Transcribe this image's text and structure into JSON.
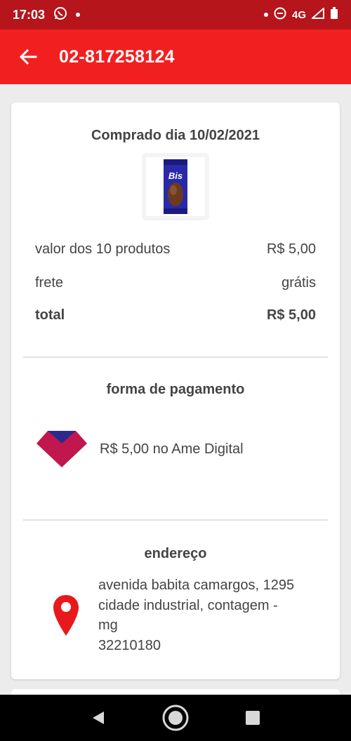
{
  "status": {
    "time": "17:03",
    "network": "4G"
  },
  "header": {
    "title": "02-817258124"
  },
  "order": {
    "date_label": "Comprado dia 10/02/2021",
    "product_image": "bis-chocolate-product"
  },
  "summary": {
    "products_label": "valor dos 10 produtos",
    "products_value": "R$ 5,00",
    "shipping_label": "frete",
    "shipping_value": "grátis",
    "total_label": "total",
    "total_value": "R$ 5,00"
  },
  "payment": {
    "title": "forma de pagamento",
    "method_text": "R$ 5,00 no Ame Digital",
    "logo": "ame-digital-logo"
  },
  "address": {
    "title": "endereço",
    "line1": "avenida babita camargos, 1295",
    "line2": "cidade industrial, contagem -",
    "line3": "mg",
    "zip": "32210180",
    "icon": "location-pin-icon"
  },
  "colors": {
    "status_bar": "#b5151b",
    "app_bar": "#f21f21",
    "pin": "#e8191c",
    "ame_logo": "#c0174f"
  }
}
